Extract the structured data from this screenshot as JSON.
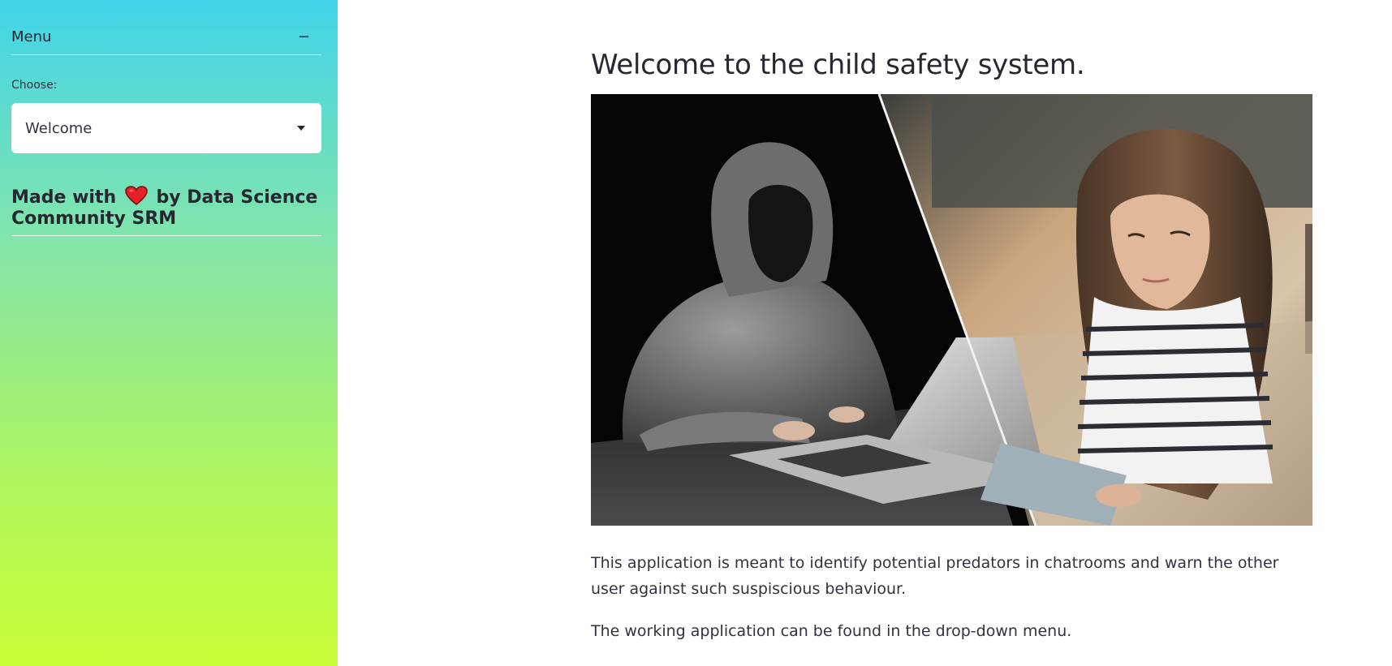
{
  "sidebar": {
    "menu_title": "Menu",
    "collapse_symbol": "−",
    "choose_label": "Choose:",
    "select_value": "Welcome",
    "made_with_prefix": "Made with",
    "made_with_suffix": "by Data Science Community SRM",
    "heart_icon": "heart-icon",
    "gradient_colors": [
      "#41d3ea",
      "#86e6a7",
      "#aef55e",
      "#c9ff38"
    ]
  },
  "main": {
    "title": "Welcome to the child safety system.",
    "paragraph1": "This application is meant to identify potential predators in chatrooms and warn the other user against such suspiscious behaviour.",
    "paragraph2": "The working application can be found in the drop-down menu."
  }
}
